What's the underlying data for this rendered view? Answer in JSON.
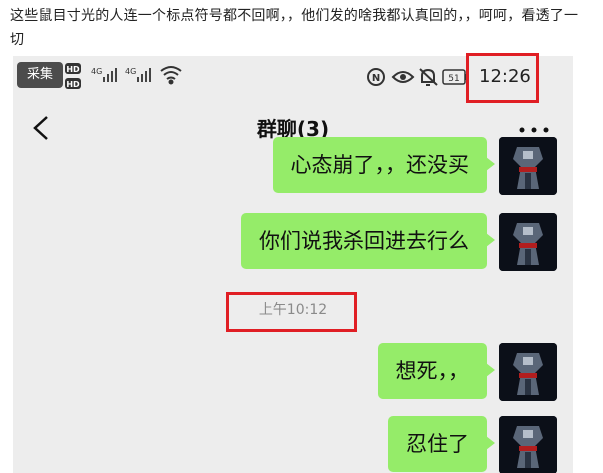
{
  "caption": "这些鼠目寸光的人连一个标点符号都不回啊，，他们发的啥我都认真回的，，呵呵，看透了一切",
  "status_bar": {
    "collect_button": "采集",
    "hd_badge_1": "HD",
    "hd_badge_2": "HD",
    "network_1": "4G",
    "network_2": "4G",
    "nfc_badge": "N",
    "battery_level": "51",
    "time": "12:26"
  },
  "navbar": {
    "title": "群聊(3)",
    "back_icon": "chevron-left-icon",
    "more_icon": "more-dots-icon"
  },
  "messages": [
    {
      "text": "心态崩了，，还没买"
    },
    {
      "text": "你们说我杀回进去行么"
    },
    {
      "text": "想死，，"
    },
    {
      "text": "忍住了"
    }
  ],
  "timestamp": "上午10:12",
  "colors": {
    "bubble": "#95ec69",
    "chat_background": "#ededed",
    "highlight": "#e01e24"
  }
}
